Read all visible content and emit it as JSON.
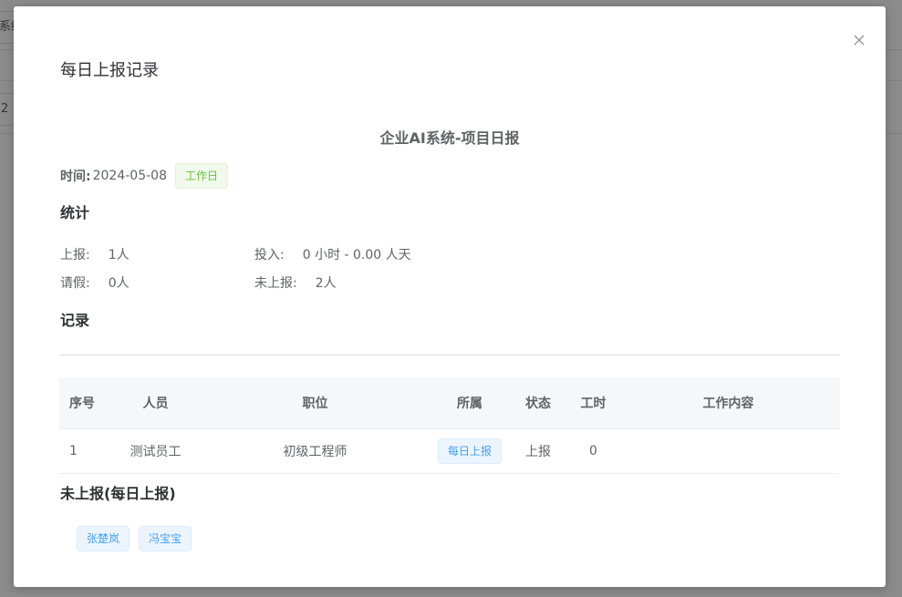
{
  "background": {
    "fragment_1": "系统",
    "fragment_2": "2"
  },
  "dialog": {
    "title": "每日上报记录",
    "close_icon": "close-icon"
  },
  "report": {
    "title": "企业AI系统-项目日报",
    "date_label": "时间:",
    "date_value": "2024-05-08",
    "day_type_tag": "工作日"
  },
  "stats": {
    "heading": "统计",
    "reported_label": "上报:",
    "reported_value": "1人",
    "leave_label": "请假:",
    "leave_value": "0人",
    "input_label": "投入:",
    "input_value": "0 小时 - 0.00 人天",
    "unreported_label": "未上报:",
    "unreported_value": "2人"
  },
  "records": {
    "heading": "记录",
    "columns": [
      "序号",
      "人员",
      "职位",
      "所属",
      "状态",
      "工时",
      "工作内容"
    ],
    "rows": [
      {
        "index": "1",
        "person": "测试员工",
        "position": "初级工程师",
        "org": "每日上报",
        "status": "上报",
        "hours": "0",
        "content": ""
      }
    ]
  },
  "unreported": {
    "heading": "未上报(每日上报)",
    "people": [
      "张楚岚",
      "冯宝宝"
    ]
  },
  "colors": {
    "tag_green_text": "#67c23a",
    "tag_blue_text": "#409eff",
    "overlay": "#8c8c8c"
  }
}
